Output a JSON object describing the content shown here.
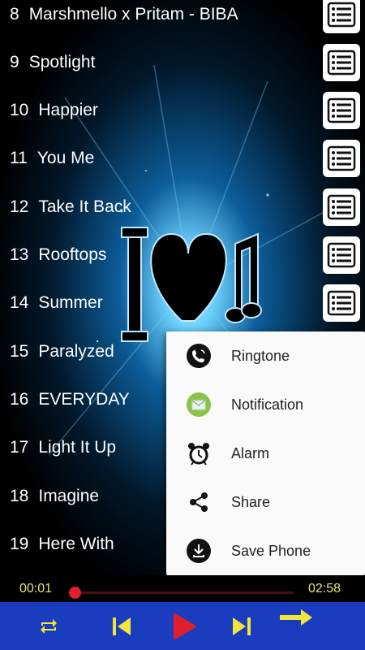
{
  "songs": [
    {
      "num": "8",
      "title": "Marshmello x Pritam - BIBA"
    },
    {
      "num": "9",
      "title": "Spotlight"
    },
    {
      "num": "10",
      "title": "Happier"
    },
    {
      "num": "11",
      "title": "You Me"
    },
    {
      "num": "12",
      "title": "Take It Back"
    },
    {
      "num": "13",
      "title": "Rooftops"
    },
    {
      "num": "14",
      "title": "Summer"
    },
    {
      "num": "15",
      "title": "Paralyzed"
    },
    {
      "num": "16",
      "title": "EVERYDAY"
    },
    {
      "num": "17",
      "title": "Light It Up"
    },
    {
      "num": "18",
      "title": "Imagine"
    },
    {
      "num": "19",
      "title": "Here With"
    }
  ],
  "popup": {
    "items": [
      {
        "label": "Ringtone",
        "icon": "phone-ring-icon"
      },
      {
        "label": "Notification",
        "icon": "envelope-icon"
      },
      {
        "label": "Alarm",
        "icon": "alarm-clock-icon"
      },
      {
        "label": "Share",
        "icon": "share-icon"
      },
      {
        "label": "Save Phone",
        "icon": "download-icon"
      }
    ]
  },
  "player": {
    "current_time": "00:01",
    "total_time": "02:58",
    "progress": 0.0
  },
  "colors": {
    "accent_red": "#e01f2a",
    "control_bar": "#1a3cbe",
    "control_icons": "#f2e63a",
    "time_text": "#e8e070"
  }
}
